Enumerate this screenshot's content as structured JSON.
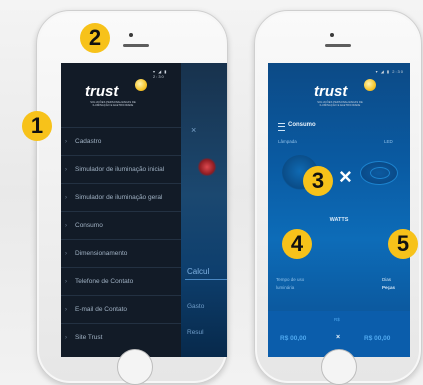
{
  "badges": {
    "b1": "1",
    "b2": "2",
    "b3": "3",
    "b4": "4",
    "b5": "5"
  },
  "left_phone": {
    "logo": "trust",
    "logo_sub_line1": "SOLUÇÕES PERSONALIZADAS DE",
    "logo_sub_line2": "ILUMINAÇÃO E ELETRICIDADE",
    "menu": [
      {
        "label": "Cadastro"
      },
      {
        "label": "Simulador de iluminação inicial"
      },
      {
        "label": "Simulador de iluminação geral"
      },
      {
        "label": "Consumo"
      },
      {
        "label": "Dimensionamento"
      },
      {
        "label": "Telefone de Contato"
      },
      {
        "label": "E-mail de Contato"
      },
      {
        "label": "Site Trust"
      }
    ],
    "behind": {
      "x": "×",
      "calc": "Calcul",
      "gasto": "Gasto",
      "result": "Resul"
    }
  },
  "right_phone": {
    "logo": "trust",
    "logo_sub_line1": "SOLUÇÕES PERSONALIZADAS DE",
    "logo_sub_line2": "ILUMINAÇÃO E ELETRICIDADE",
    "title": "Consumo",
    "subtitle_left": "Lâmpada",
    "subtitle_right": "LED",
    "x_symbol": "×",
    "watts": "WATTS",
    "hours_left": "Tempo de uso",
    "hours_left2": "luminária",
    "days_right": "Dias",
    "pieces_right": "Peças",
    "result_label": "R$",
    "price_left": "R$ 00,00",
    "price_x": "×",
    "price_right": "R$ 00,00"
  },
  "colors": {
    "badge": "#f7c21a",
    "drawer": "#121b27",
    "blue": "#0b5dab"
  }
}
